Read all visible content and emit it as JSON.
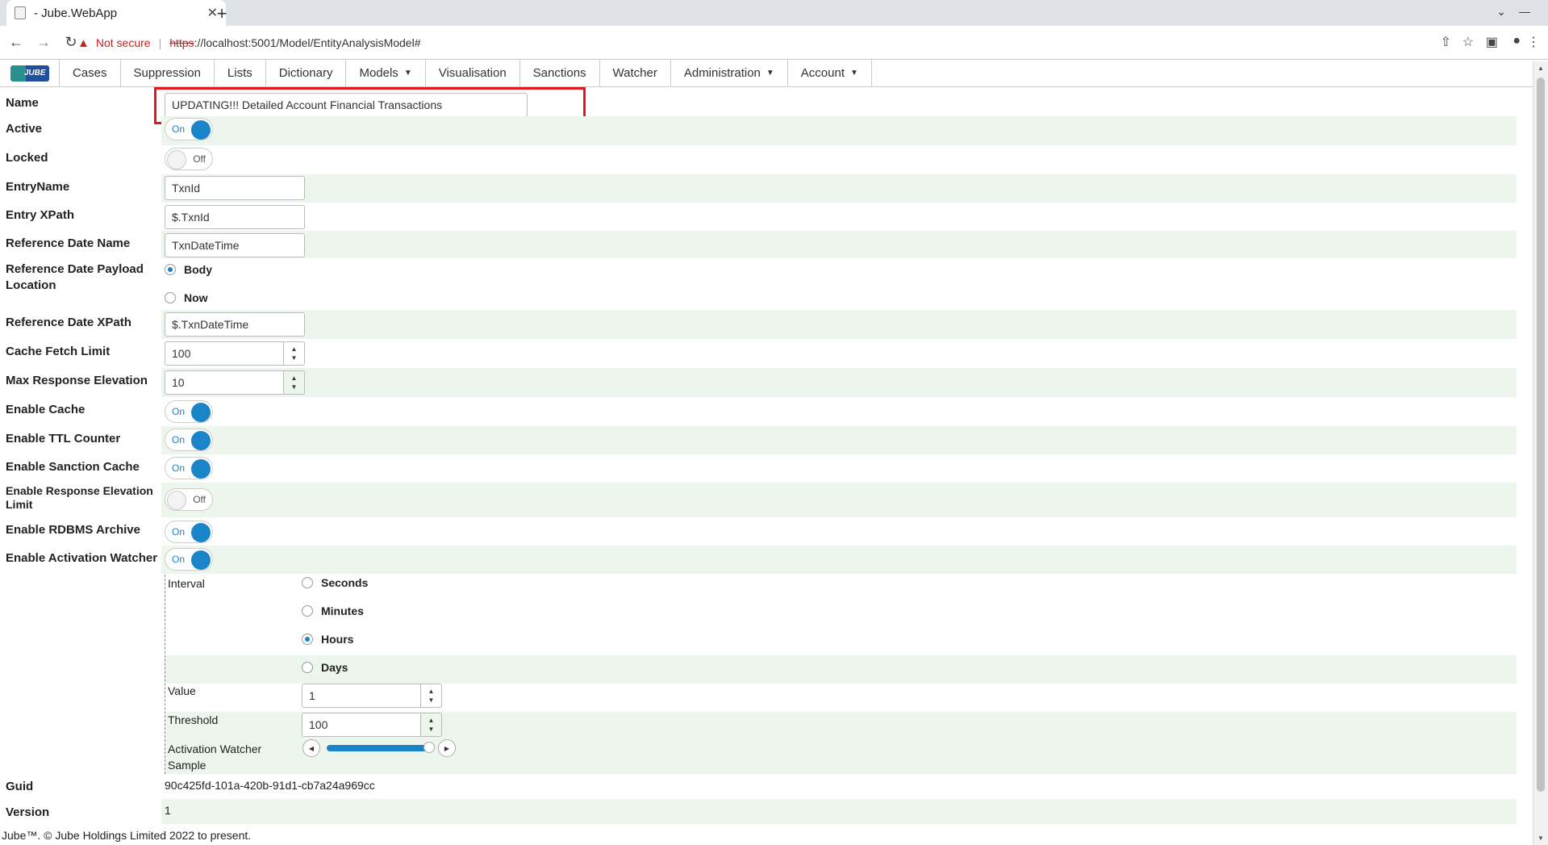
{
  "browser": {
    "tab_title": "- Jube.WebApp",
    "tab_close": "✕",
    "new_tab": "+",
    "not_secure": "Not secure",
    "url_scheme": "https",
    "url_rest": "://localhost:5001/Model/EntityAnalysisModel#"
  },
  "nav": {
    "logo_text": "JUBE",
    "items": [
      {
        "label": "Cases",
        "dropdown": false
      },
      {
        "label": "Suppression",
        "dropdown": false
      },
      {
        "label": "Lists",
        "dropdown": false
      },
      {
        "label": "Dictionary",
        "dropdown": false
      },
      {
        "label": "Models",
        "dropdown": true
      },
      {
        "label": "Visualisation",
        "dropdown": false
      },
      {
        "label": "Sanctions",
        "dropdown": false
      },
      {
        "label": "Watcher",
        "dropdown": false
      },
      {
        "label": "Administration",
        "dropdown": true
      },
      {
        "label": "Account",
        "dropdown": true
      }
    ]
  },
  "form": {
    "name": {
      "label": "Name",
      "value": "UPDATING!!! Detailed Account Financial Transactions"
    },
    "active": {
      "label": "Active",
      "state": "On"
    },
    "locked": {
      "label": "Locked",
      "state": "Off"
    },
    "entry_name": {
      "label": "EntryName",
      "value": "TxnId"
    },
    "entry_xpath": {
      "label": "Entry XPath",
      "value": "$.TxnId"
    },
    "ref_date_name": {
      "label": "Reference Date Name",
      "value": "TxnDateTime"
    },
    "ref_date_payload": {
      "label": "Reference Date Payload Location",
      "options": [
        "Body",
        "Now"
      ],
      "selected": "Body"
    },
    "ref_date_xpath": {
      "label": "Reference Date XPath",
      "value": "$.TxnDateTime"
    },
    "cache_fetch_limit": {
      "label": "Cache Fetch Limit",
      "value": "100"
    },
    "max_response_elevation": {
      "label": "Max Response Elevation",
      "value": "10"
    },
    "enable_cache": {
      "label": "Enable Cache",
      "state": "On"
    },
    "enable_ttl": {
      "label": "Enable TTL Counter",
      "state": "On"
    },
    "enable_sanction_cache": {
      "label": "Enable Sanction Cache",
      "state": "On"
    },
    "enable_resp_elev_limit": {
      "label": "Enable Response Elevation Limit",
      "state": "Off"
    },
    "enable_rdbms": {
      "label": "Enable RDBMS Archive",
      "state": "On"
    },
    "enable_watcher": {
      "label": "Enable Activation Watcher",
      "state": "On"
    },
    "interval": {
      "label": "Interval",
      "options": [
        "Seconds",
        "Minutes",
        "Hours",
        "Days"
      ],
      "selected": "Hours"
    },
    "value": {
      "label": "Value",
      "value": "1"
    },
    "threshold": {
      "label": "Threshold",
      "value": "100"
    },
    "watcher_sample": {
      "label": "Activation Watcher Sample",
      "fraction": 0.98
    },
    "guid": {
      "label": "Guid",
      "value": "90c425fd-101a-420b-91d1-cb7a24a969cc"
    },
    "version": {
      "label": "Version",
      "value": "1"
    }
  },
  "footer": "Jube™. © Jube Holdings Limited 2022 to present."
}
